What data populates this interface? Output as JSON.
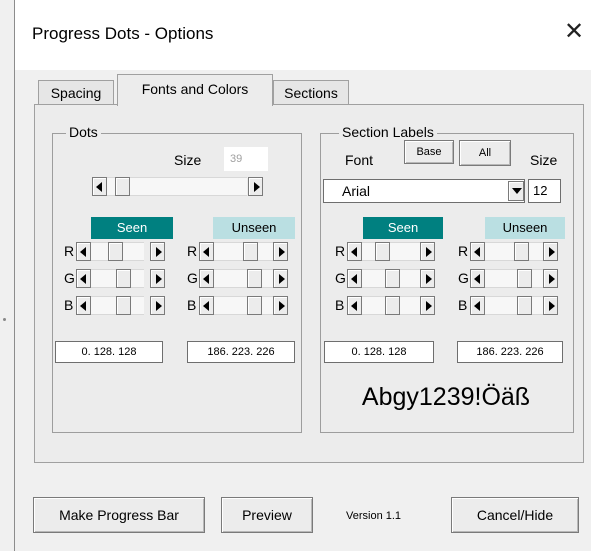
{
  "window": {
    "title": "Progress Dots - Options",
    "close_icon": "close-icon"
  },
  "tabs": [
    {
      "label": "Spacing",
      "active": false
    },
    {
      "label": "Fonts and Colors",
      "active": true
    },
    {
      "label": "Sections",
      "active": false
    }
  ],
  "dots": {
    "title": "Dots",
    "size_label": "Size",
    "size_value": "39",
    "seen_label": "Seen",
    "unseen_label": "Unseen",
    "seen_value": "0. 128. 128",
    "unseen_value": "186. 223. 226"
  },
  "section_labels": {
    "title": "Section Labels",
    "font_label": "Font",
    "base_button": "Base",
    "all_button": "All",
    "size_label": "Size",
    "font_value": "Arial",
    "size_value": "12",
    "seen_label": "Seen",
    "unseen_label": "Unseen",
    "seen_value": "0. 128. 128",
    "unseen_value": "186. 223. 226",
    "sample_text": "Abgy1239!Öäß"
  },
  "channels": [
    "R",
    "G",
    "B"
  ],
  "colors": {
    "seen": "#008080",
    "unseen": "#badfe2"
  },
  "footer": {
    "make_button": "Make Progress Bar",
    "preview_button": "Preview",
    "version": "Version 1.1",
    "cancel_button": "Cancel/Hide"
  }
}
